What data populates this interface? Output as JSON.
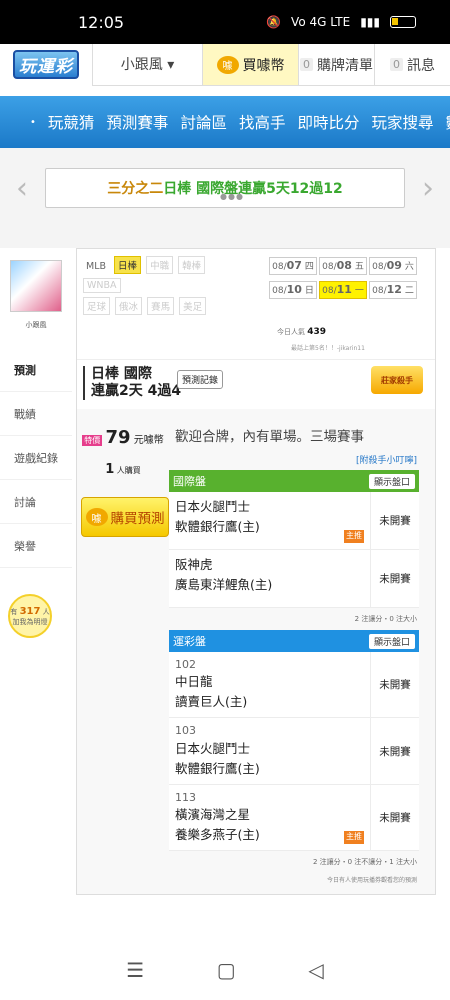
{
  "status_bar": {
    "time": "12:05",
    "network": "Vo 4G LTE"
  },
  "top_nav": {
    "logo": "玩運彩",
    "user": "小跟風 ▾",
    "buy_coin": "買噱幣",
    "coin_icon": "噱",
    "list": {
      "count": "0",
      "label": "購牌清單"
    },
    "messages": {
      "count": "0",
      "label": "訊息"
    }
  },
  "menu": [
    "玩競猜",
    "預測賽事",
    "討論區",
    "找高手",
    "即時比分",
    "玩家搜尋",
    "數據"
  ],
  "banner": {
    "prefix": "三分之二 ",
    "highlight": "日棒 國際盤連贏5天12過12"
  },
  "sidebar": {
    "avatar_name": "小跟風",
    "items": [
      "預測",
      "戰績",
      "遊戲紀錄",
      "討論",
      "榮譽"
    ],
    "bulb": {
      "count": "317",
      "unit": "人",
      "prefix": "有",
      "label": "加我為明燈"
    }
  },
  "filters": {
    "row1": [
      "MLB",
      "日棒",
      "中職",
      "韓棒"
    ],
    "row2": [
      "WNBA"
    ],
    "row3": [
      "足球",
      "俄冰",
      "賽馬",
      "美足"
    ]
  },
  "dates": [
    {
      "md": "08/",
      "d": "07",
      "wd": "四"
    },
    {
      "md": "08/",
      "d": "08",
      "wd": "五"
    },
    {
      "md": "08/",
      "d": "09",
      "wd": "六"
    },
    {
      "md": "08/",
      "d": "10",
      "wd": "日"
    },
    {
      "md": "08/",
      "d": "11",
      "wd": "一"
    },
    {
      "md": "08/",
      "d": "12",
      "wd": "二"
    }
  ],
  "popularity": {
    "label": "今日人氣",
    "value": "439",
    "sub": "最話上第5名！！-jikarin11"
  },
  "record": {
    "title_line1": "日棒 國際",
    "title_line2": "連贏2天 4過4",
    "button": "預測記錄",
    "expert": "莊家殺手"
  },
  "purchase": {
    "sale": "特價",
    "price": "79",
    "unit": "元噱幣",
    "buyers": "1",
    "buyers_unit": "人購買",
    "buy_button": "購買預測"
  },
  "welcome": "歡迎合牌，內有單場。三場賽事",
  "hint": "[附殺手小叮嚀]",
  "intl_panel": {
    "title": "國際盤",
    "show": "顯示盤口",
    "matches": [
      {
        "home": "日本火腿鬥士",
        "away": "軟體銀行鷹(主)",
        "status": "未開賽",
        "tag": "主推"
      },
      {
        "home": "阪神虎",
        "away": "廣島東洋鯉魚(主)",
        "status": "未開賽",
        "tag": ""
      }
    ],
    "footer": "2 注讓分・0 注大小"
  },
  "lottery_panel": {
    "title": "運彩盤",
    "show": "顯示盤口",
    "matches": [
      {
        "num": "102",
        "home": "中日龍",
        "away": "讀賣巨人(主)",
        "status": "未開賽",
        "tag": ""
      },
      {
        "num": "103",
        "home": "日本火腿鬥士",
        "away": "軟體銀行鷹(主)",
        "status": "未開賽",
        "tag": ""
      },
      {
        "num": "113",
        "home": "橫濱海灣之星",
        "away": "養樂多燕子(主)",
        "status": "未開賽",
        "tag": "主推"
      }
    ],
    "footer": "2 注讓分・0 注不讓分・1 注大小"
  },
  "bottom_note": "今日有人使用玩播券觀看您的預測",
  "nav_buttons": {
    "menu": "☰",
    "home": "▢",
    "back": "◁"
  }
}
